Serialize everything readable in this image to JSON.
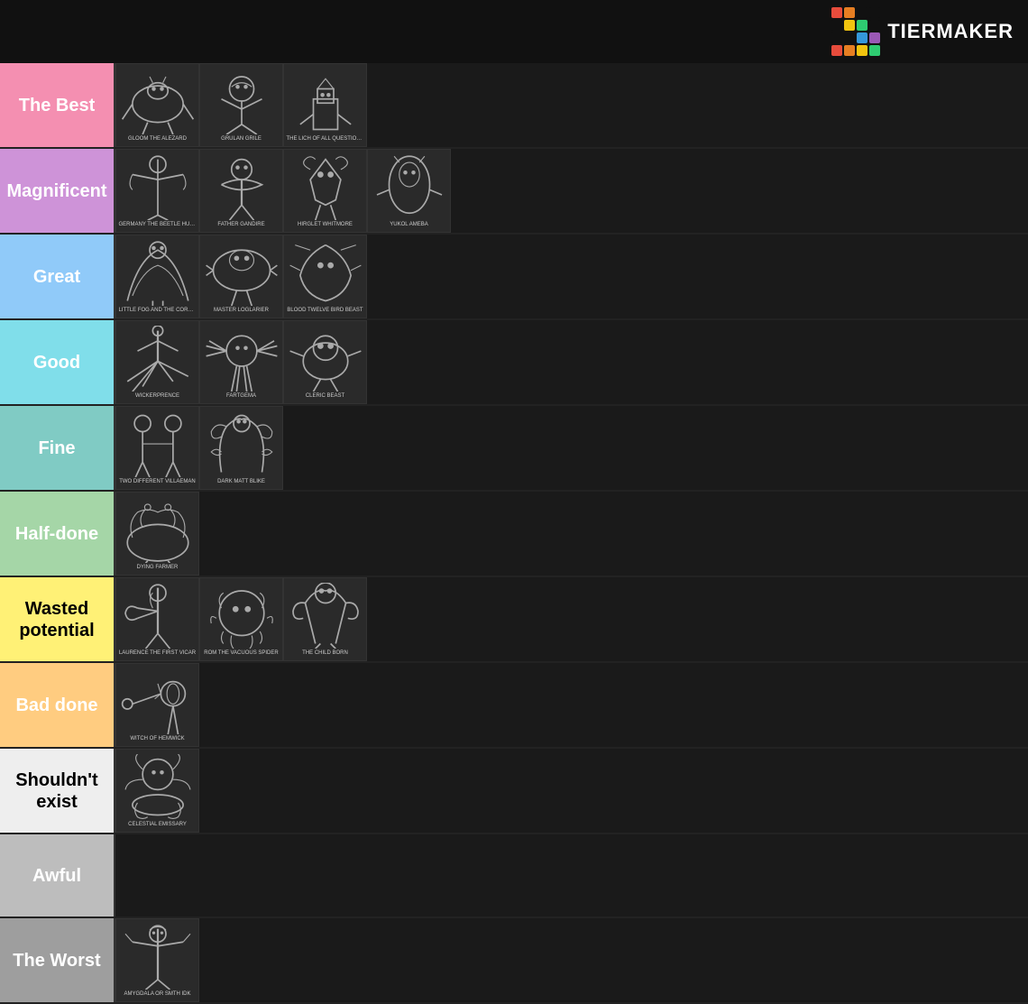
{
  "header": {
    "logo_text": "TiERMAKER",
    "logo_colors": [
      "#e74c3c",
      "#e67e22",
      "#f1c40f",
      "#2ecc71",
      "#3498db",
      "#9b59b6",
      "#1abc9c",
      "#e74c3c",
      "#f39c12",
      "#27ae60",
      "#2980b9",
      "#8e44ad",
      "#e74c3c",
      "#e67e22",
      "#f1c40f",
      "#2ecc71"
    ]
  },
  "tiers": [
    {
      "id": "the-best",
      "label": "The Best",
      "color": "#f48fb1",
      "text_color": "white",
      "items": [
        {
          "label": "GLOOM THE ALEZARD",
          "desc": "creature1"
        },
        {
          "label": "GRULAN GRILE",
          "desc": "creature2"
        },
        {
          "label": "THE LICH OF ALL QUESTIONS",
          "desc": "creature3"
        }
      ]
    },
    {
      "id": "magnificent",
      "label": "Magnificent",
      "color": "#ce93d8",
      "text_color": "white",
      "items": [
        {
          "label": "GERMANY THE BEETLE HUNTER",
          "desc": "creature4"
        },
        {
          "label": "FATHER GANDIRE",
          "desc": "creature5"
        },
        {
          "label": "HIRGLET WHITMORE",
          "desc": "creature6"
        },
        {
          "label": "YUKOL AMEBA",
          "desc": "creature7"
        }
      ]
    },
    {
      "id": "great",
      "label": "Great",
      "color": "#90caf9",
      "text_color": "white",
      "items": [
        {
          "label": "LITTLE FOG AND THE CORROSIONIST",
          "desc": "creature8"
        },
        {
          "label": "MASTER LOGLARIER",
          "desc": "creature9"
        },
        {
          "label": "BLOOD TWELVE BIRD BEAST",
          "desc": "creature10"
        }
      ]
    },
    {
      "id": "good",
      "label": "Good",
      "color": "#80deea",
      "text_color": "white",
      "items": [
        {
          "label": "WICKERPRENCE",
          "desc": "creature11"
        },
        {
          "label": "FARTGEMA",
          "desc": "creature12"
        },
        {
          "label": "CLERIC BEAST",
          "desc": "creature13"
        }
      ]
    },
    {
      "id": "fine",
      "label": "Fine",
      "color": "#80cbc4",
      "text_color": "white",
      "items": [
        {
          "label": "TWO DIFFERENT VILLAEMAN",
          "desc": "creature14"
        },
        {
          "label": "DARK MATT BLIKE",
          "desc": "creature15"
        }
      ]
    },
    {
      "id": "half-done",
      "label": "Half-done",
      "color": "#a5d6a7",
      "text_color": "white",
      "items": [
        {
          "label": "DYING FARMER",
          "desc": "creature16"
        }
      ]
    },
    {
      "id": "wasted",
      "label": "Wasted potential",
      "color": "#fff176",
      "text_color": "black",
      "items": [
        {
          "label": "LAURENCE THE FIRST VICAR",
          "desc": "creature17"
        },
        {
          "label": "ROM THE VACUOUS SPIDER",
          "desc": "creature18"
        },
        {
          "label": "THE CHILD BORN",
          "desc": "creature19"
        }
      ]
    },
    {
      "id": "bad-done",
      "label": "Bad done",
      "color": "#ffcc80",
      "text_color": "white",
      "items": [
        {
          "label": "WITCH OF HEMWICK",
          "desc": "creature20"
        }
      ]
    },
    {
      "id": "shouldnt",
      "label": "Shouldn't exist",
      "color": "#eeeeee",
      "text_color": "black",
      "items": [
        {
          "label": "CELESTIAL EMISSARY",
          "desc": "creature21"
        }
      ]
    },
    {
      "id": "awful",
      "label": "Awful",
      "color": "#bdbdbd",
      "text_color": "white",
      "items": []
    },
    {
      "id": "the-worst",
      "label": "The Worst",
      "color": "#9e9e9e",
      "text_color": "white",
      "items": [
        {
          "label": "AMYGDALA OR SMTH IDK",
          "desc": "creature22"
        }
      ]
    }
  ]
}
